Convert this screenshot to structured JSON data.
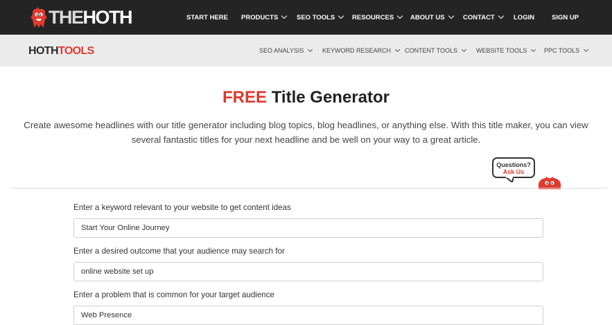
{
  "brand": {
    "logo_the": "THE",
    "logo_hoth": "HOTH"
  },
  "topnav": {
    "items": [
      {
        "label": "START HERE",
        "dropdown": false
      },
      {
        "label": "PRODUCTS",
        "dropdown": true
      },
      {
        "label": "SEO TOOLS",
        "dropdown": true
      },
      {
        "label": "RESOURCES",
        "dropdown": true
      },
      {
        "label": "ABOUT US",
        "dropdown": true
      },
      {
        "label": "CONTACT",
        "dropdown": true
      },
      {
        "label": "LOGIN",
        "dropdown": false
      },
      {
        "label": "SIGN UP",
        "dropdown": false
      }
    ]
  },
  "tools_brand": {
    "part1": "HOTH",
    "part2": "TOOLS"
  },
  "subnav": {
    "items": [
      {
        "label": "SEO ANALYSIS"
      },
      {
        "label": "KEYWORD RESEARCH"
      },
      {
        "label": "CONTENT TOOLS"
      },
      {
        "label": "WEBSITE TOOLS"
      },
      {
        "label": "PPC TOOLS"
      }
    ]
  },
  "page": {
    "title_free": "FREE",
    "title_rest": " Title Generator",
    "intro": "Create awesome headlines with our title generator including blog topics, blog headlines, or anything else. With this title maker, you can view several fantastic titles for your next headline and be well on your way to a great article."
  },
  "help": {
    "line1": "Questions?",
    "line2": "Ask Us"
  },
  "form": {
    "fields": [
      {
        "label": "Enter a keyword relevant to your website to get content ideas",
        "value": "Start Your Online Journey"
      },
      {
        "label": "Enter a desired outcome that your audience may search for",
        "value": "online website set up"
      },
      {
        "label": "Enter a problem that is common for your target audience",
        "value": "Web Presence"
      }
    ]
  },
  "colors": {
    "accent": "#dd3a2c",
    "topbar_bg": "#242424",
    "subbar_bg": "#ebebeb"
  },
  "icons": {
    "logo_mascot": "red-monster-mascot-icon",
    "help_mascot": "red-monster-peek-icon",
    "dropdown": "chevron-down-icon"
  }
}
